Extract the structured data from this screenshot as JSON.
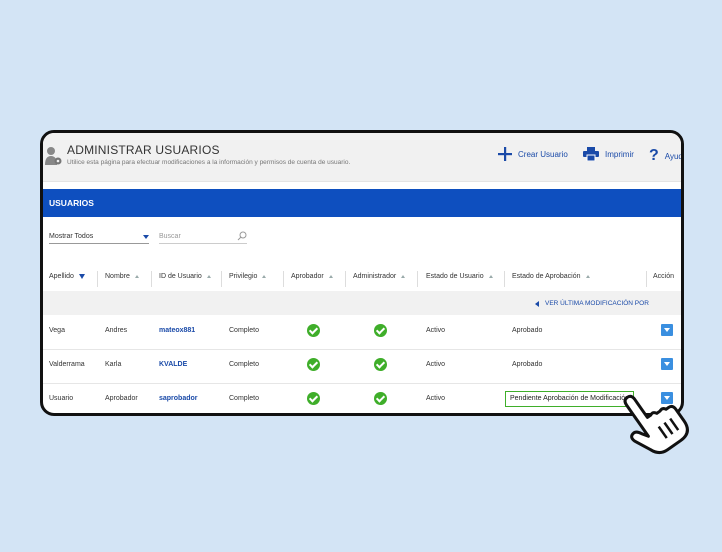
{
  "header": {
    "title": "ADMINISTRAR USUARIOS",
    "subtitle": "Utilice esta página para efectuar modificaciones a la información y permisos de cuenta de usuario.",
    "actions": [
      {
        "label": "Crear Usuario",
        "icon": "plus-icon"
      },
      {
        "label": "Imprimir",
        "icon": "printer-icon"
      },
      {
        "label": "Ayuda",
        "icon": "help-icon"
      }
    ]
  },
  "banner": {
    "title": "USUARIOS"
  },
  "filters": {
    "show_all": "Mostrar Todos",
    "search_placeholder": "Buscar"
  },
  "table": {
    "columns": [
      "Apellido",
      "Nombre",
      "ID de Usuario",
      "Privilegio",
      "Aprobador",
      "Administrador",
      "Estado de Usuario",
      "Estado de Aprobación",
      "Acción"
    ],
    "sub_link": "VER ÚLTIMA MODIFICACIÓN POR",
    "rows": [
      {
        "apellido": "Vega",
        "nombre": "Andres",
        "id": "mateox881",
        "privilegio": "Completo",
        "aprobador": true,
        "administrador": true,
        "estado_usuario": "Activo",
        "estado_aprobacion": "Aprobado"
      },
      {
        "apellido": "Valderrama",
        "nombre": "Karla",
        "id": "KVALDE",
        "privilegio": "Completo",
        "aprobador": true,
        "administrador": true,
        "estado_usuario": "Activo",
        "estado_aprobacion": "Aprobado"
      },
      {
        "apellido": "Usuario",
        "nombre": "Aprobador",
        "id": "saprobador",
        "privilegio": "Completo",
        "aprobador": true,
        "administrador": true,
        "estado_usuario": "Activo",
        "estado_aprobacion": "Pendiente Aprobación de Modificación"
      }
    ]
  },
  "colors": {
    "accent": "#0e4fbf",
    "check": "#3fae2a",
    "background": "#d3e4f5"
  }
}
